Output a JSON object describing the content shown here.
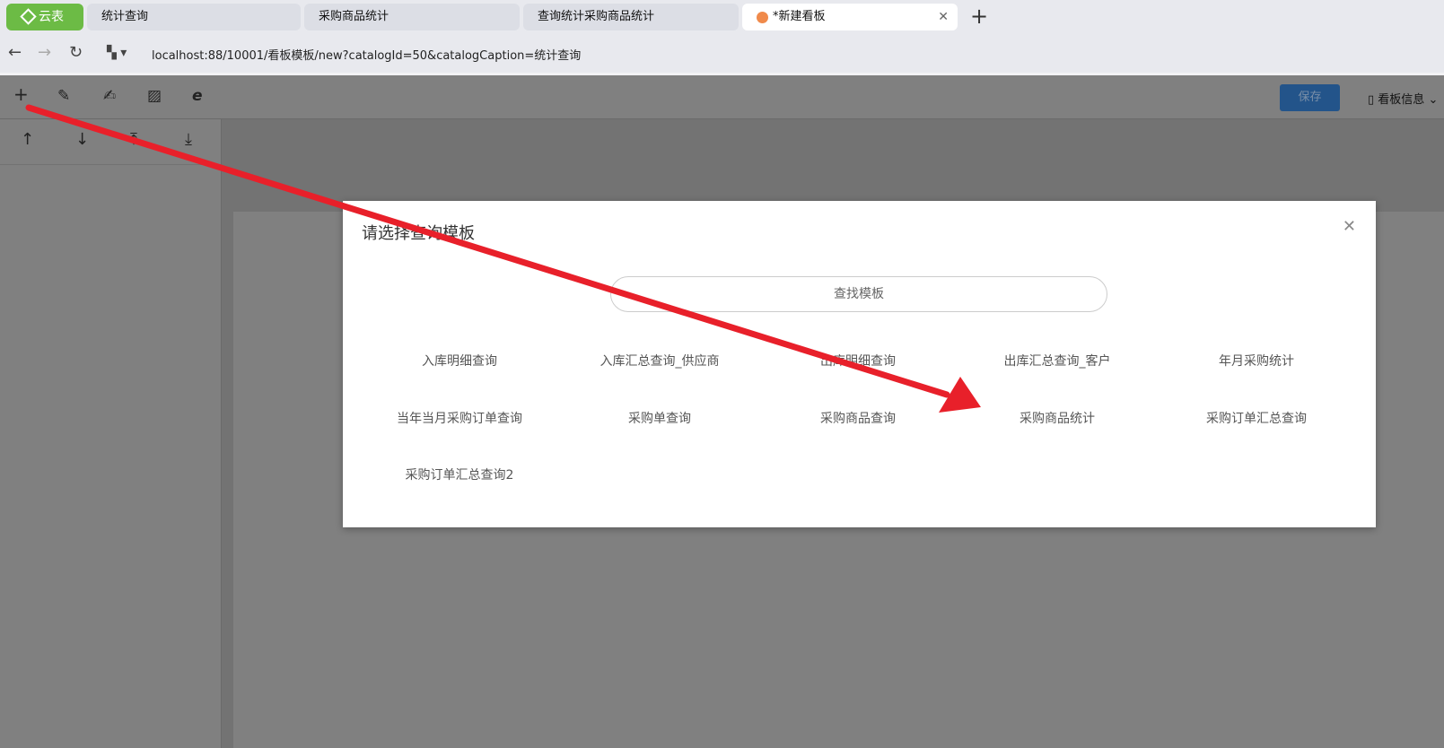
{
  "browser": {
    "brand": "云表",
    "tabs": [
      {
        "label": "统计查询"
      },
      {
        "label": "采购商品统计"
      },
      {
        "label": "查询统计采购商品统计"
      },
      {
        "label": "*新建看板",
        "active": true
      }
    ],
    "url": "localhost:88/10001/看板模板/new?catalogId=50&catalogCaption=统计查询"
  },
  "toolbar": {
    "save_label": "保存",
    "info_label": "看板信息"
  },
  "dialog": {
    "title": "请选择查询模板",
    "search_placeholder": "查找模板",
    "items": [
      "入库明细查询",
      "入库汇总查询_供应商",
      "出库明细查询",
      "出库汇总查询_客户",
      "年月采购统计",
      "当年当月采购订单查询",
      "采购单查询",
      "采购商品查询",
      "采购商品统计",
      "采购订单汇总查询",
      "采购订单汇总查询2"
    ]
  },
  "annotation_color": "#e8202a"
}
